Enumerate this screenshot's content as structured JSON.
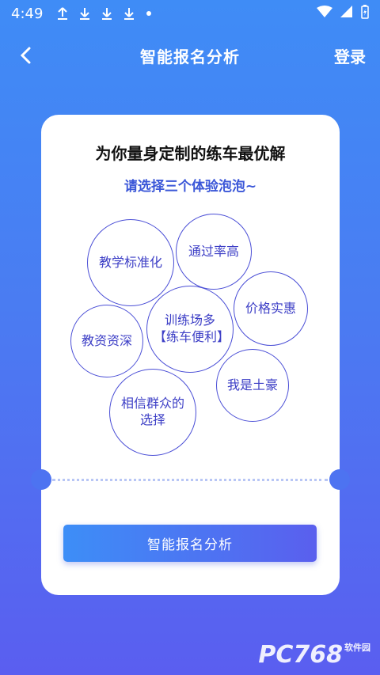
{
  "status_bar": {
    "time": "4:49"
  },
  "header": {
    "title": "智能报名分析",
    "login": "登录"
  },
  "card": {
    "title": "为你量身定制的练车最优解",
    "subtitle": "请选择三个体验泡泡~",
    "bubbles": [
      "教学标准化",
      "通过率高",
      "价格实惠",
      "训练场多【练车便利】",
      "教资资深",
      "我是土豪",
      "相信群众的选择"
    ],
    "button": "智能报名分析"
  },
  "watermark": {
    "brand": "PC768",
    "tag": "软件园"
  }
}
